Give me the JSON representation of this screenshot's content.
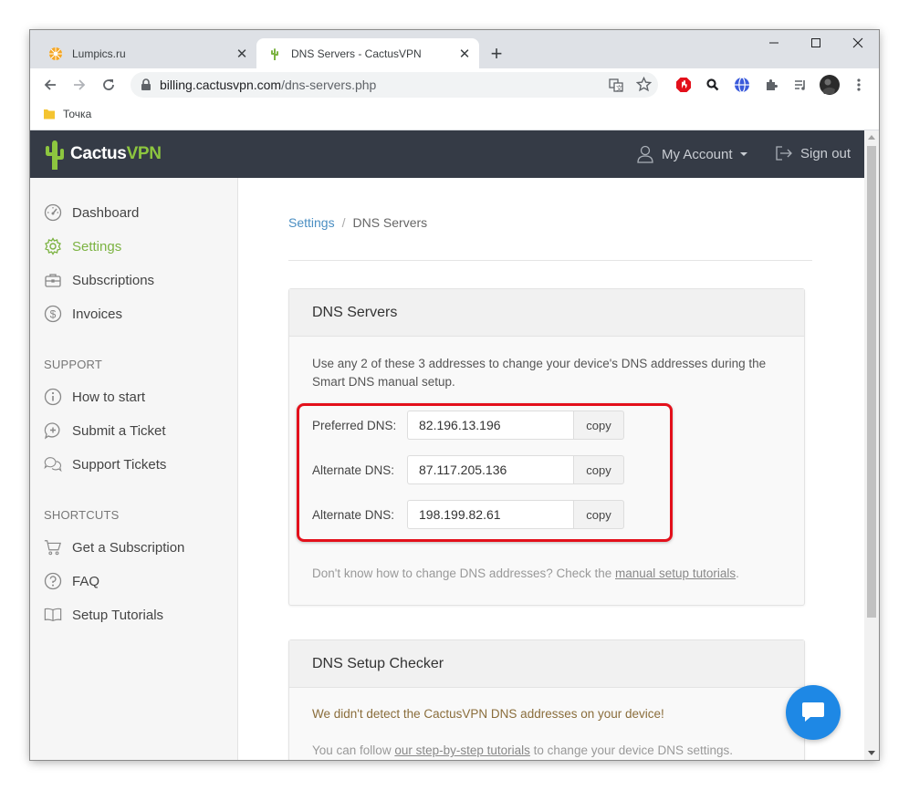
{
  "browser": {
    "tabs": [
      {
        "title": "Lumpics.ru",
        "active": false,
        "close": "✕"
      },
      {
        "title": "DNS Servers - CactusVPN",
        "active": true,
        "close": "✕"
      }
    ],
    "new_tab": "+",
    "url_host": "billing.cactusvpn.com",
    "url_path": "/dns-servers.php",
    "bookmark": "Точка",
    "icons": [
      "back-icon",
      "forward-icon",
      "reload-icon",
      "lock-icon",
      "translate-icon",
      "star-icon",
      "adblock-icon",
      "search-ext-icon",
      "vpn-ext-icon",
      "extensions-icon",
      "reading-list-icon",
      "profile-avatar",
      "menu-icon"
    ]
  },
  "site": {
    "logo_main": "Cactus",
    "logo_accent": "VPN",
    "my_account": "My Account",
    "sign_out": "Sign out",
    "brand_color": "#8dc63f",
    "header_bg": "#353b46"
  },
  "sidebar": {
    "items": [
      {
        "label": "Dashboard",
        "icon": "gauge-icon"
      },
      {
        "label": "Settings",
        "icon": "gear-icon",
        "active": true
      },
      {
        "label": "Subscriptions",
        "icon": "briefcase-icon"
      },
      {
        "label": "Invoices",
        "icon": "dollar-circle-icon"
      }
    ],
    "support_heading": "SUPPORT",
    "support": [
      {
        "label": "How to start",
        "icon": "info-icon"
      },
      {
        "label": "Submit a Ticket",
        "icon": "chat-plus-icon"
      },
      {
        "label": "Support Tickets",
        "icon": "chats-icon"
      }
    ],
    "shortcuts_heading": "SHORTCUTS",
    "shortcuts": [
      {
        "label": "Get a Subscription",
        "icon": "cart-icon"
      },
      {
        "label": "FAQ",
        "icon": "question-icon"
      },
      {
        "label": "Setup Tutorials",
        "icon": "book-icon"
      }
    ]
  },
  "breadcrumb": {
    "parent": "Settings",
    "separator": "/",
    "current": "DNS Servers"
  },
  "dns_card": {
    "title": "DNS Servers",
    "description": "Use any 2 of these 3 addresses to change your device's DNS addresses during the Smart DNS manual setup.",
    "rows": [
      {
        "label": "Preferred DNS:",
        "ip": "82.196.13.196",
        "copy": "copy"
      },
      {
        "label": "Alternate DNS:",
        "ip": "87.117.205.136",
        "copy": "copy"
      },
      {
        "label": "Alternate DNS:",
        "ip": "198.199.82.61",
        "copy": "copy"
      }
    ],
    "help_prefix": "Don't know how to change DNS addresses? Check the ",
    "help_link": "manual setup tutorials",
    "help_suffix": "."
  },
  "checker_card": {
    "title": "DNS Setup Checker",
    "warning": "We didn't detect the CactusVPN DNS addresses on your device!",
    "follow_prefix": "You can follow ",
    "follow_link": "our step-by-step tutorials",
    "follow_suffix": " to change your device DNS settings."
  },
  "highlight_color": "#e3101b"
}
